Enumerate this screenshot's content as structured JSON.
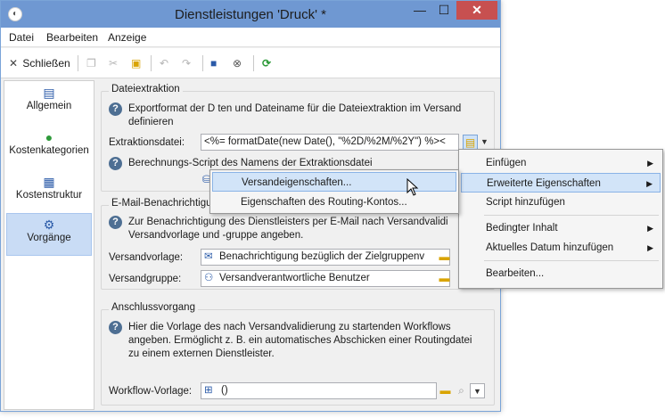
{
  "window": {
    "title": "Dienstleistungen 'Druck' *",
    "minimize": "—",
    "maximize": "☐",
    "close": "✕"
  },
  "menu": [
    "Datei",
    "Bearbeiten",
    "Anzeige"
  ],
  "toolbar": {
    "close_label": "Schließen"
  },
  "sidebar": {
    "items": [
      {
        "label": "Allgemein",
        "icon": "clipboard-icon"
      },
      {
        "label": "Kostenkategorien",
        "icon": "money-pin-icon"
      },
      {
        "label": "Kostenstruktur",
        "icon": "table-icon"
      },
      {
        "label": "Vorgänge",
        "icon": "gears-icon"
      }
    ]
  },
  "extraction": {
    "title": "Dateiextraktion",
    "help_line1": "Exportformat der D   ten und Dateiname für die Dateiextraktion im Versand",
    "help_line2": "definieren",
    "field_label": "Extraktionsdatei:",
    "field_value": "<%= formatDate(new Date(), \"%2D/%2M/%2Y\") %><",
    "script_help": "Berechnungs-Script des Namens der Extraktionsdatei"
  },
  "email": {
    "title": "E-Mail-Benachrichtigu",
    "help_line1": "Zur Benachrichtigung des Dienstleisters per E-Mail nach Versandvalidi",
    "help_line2": "Versandvorlage und -gruppe angeben.",
    "template_label": "Versandvorlage:",
    "template_value": "Benachrichtigung bezüglich der Zielgruppenv",
    "group_label": "Versandgruppe:",
    "group_value": "Versandverantwortliche Benutzer"
  },
  "followup": {
    "title": "Anschlussvorgang",
    "help_line1": "Hier die Vorlage des nach Versandvalidierung zu startenden Workflows",
    "help_line2": "angeben. Ermöglicht z. B. ein automatisches Abschicken einer Routingdatei",
    "help_line3": "zu einem externen Dienstleister.",
    "workflow_label": "Workflow-Vorlage:",
    "workflow_value": "()"
  },
  "context_menu": {
    "items": [
      "Einfügen",
      "Erweiterte Eigenschaften",
      "Script hinzufügen",
      "Bedingter Inhalt",
      "Aktuelles Datum hinzufügen",
      "Bearbeiten..."
    ]
  },
  "submenu": {
    "items": [
      "Versandeigenschaften...",
      "Eigenschaften des Routing-Kontos..."
    ]
  },
  "colors": {
    "titlebar": "#6f98d2",
    "close": "#c75050",
    "highlight": "#d2e4f8"
  }
}
